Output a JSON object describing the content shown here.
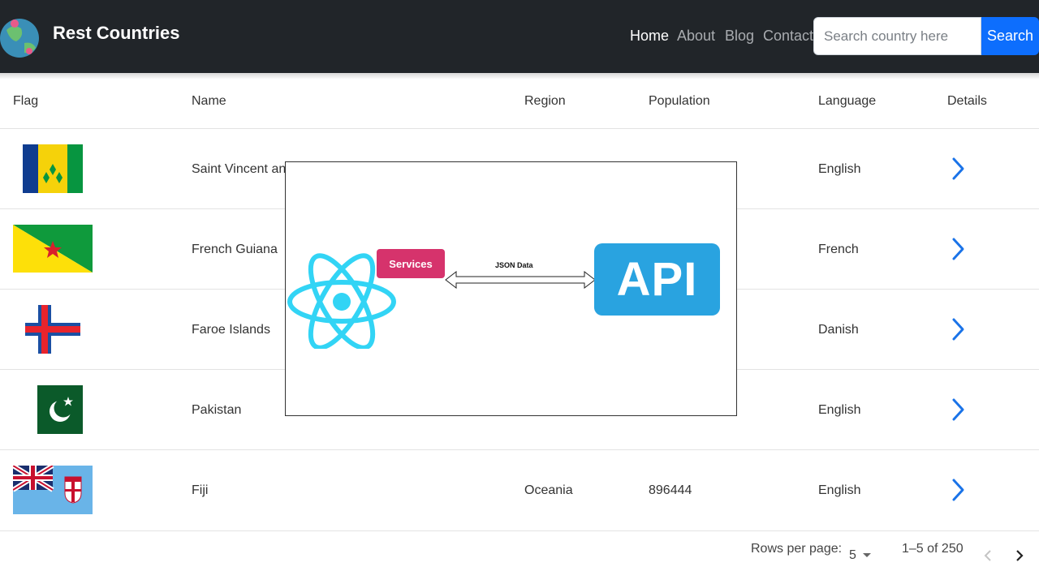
{
  "navbar": {
    "brand": "Rest Countries",
    "links": [
      "Home",
      "About",
      "Blog",
      "Contact"
    ],
    "active": "Home",
    "search_placeholder": "Search country here",
    "search_button": "Search"
  },
  "table": {
    "headers": [
      "Flag",
      "Name",
      "Region",
      "Population",
      "Language",
      "Details"
    ],
    "rows": [
      {
        "name": "Saint Vincent and",
        "region": "",
        "population": "",
        "language": "English",
        "flag": "saint-vincent-flag"
      },
      {
        "name": "French Guiana",
        "region": "",
        "population": "",
        "language": "French",
        "flag": "french-guiana-flag"
      },
      {
        "name": "Faroe Islands",
        "region": "",
        "population": "",
        "language": "Danish",
        "flag": "faroe-islands-flag"
      },
      {
        "name": "Pakistan",
        "region": "",
        "population": "",
        "language": "English",
        "flag": "pakistan-flag"
      },
      {
        "name": "Fiji",
        "region": "Oceania",
        "population": "896444",
        "language": "English",
        "flag": "fiji-flag"
      }
    ]
  },
  "pagination": {
    "rows_per_page_label": "Rows per page:",
    "rows_per_page_value": "5",
    "range": "1–5 of 250"
  },
  "diagram": {
    "services_label": "Services",
    "arrow_label": "JSON Data",
    "api_label": "API"
  },
  "colors": {
    "navbar_bg": "#212529",
    "search_button": "#0d6efd",
    "chevron": "#1a73e8",
    "services": "#d6336c",
    "api": "#29a3e0",
    "react": "#32d4f5"
  }
}
